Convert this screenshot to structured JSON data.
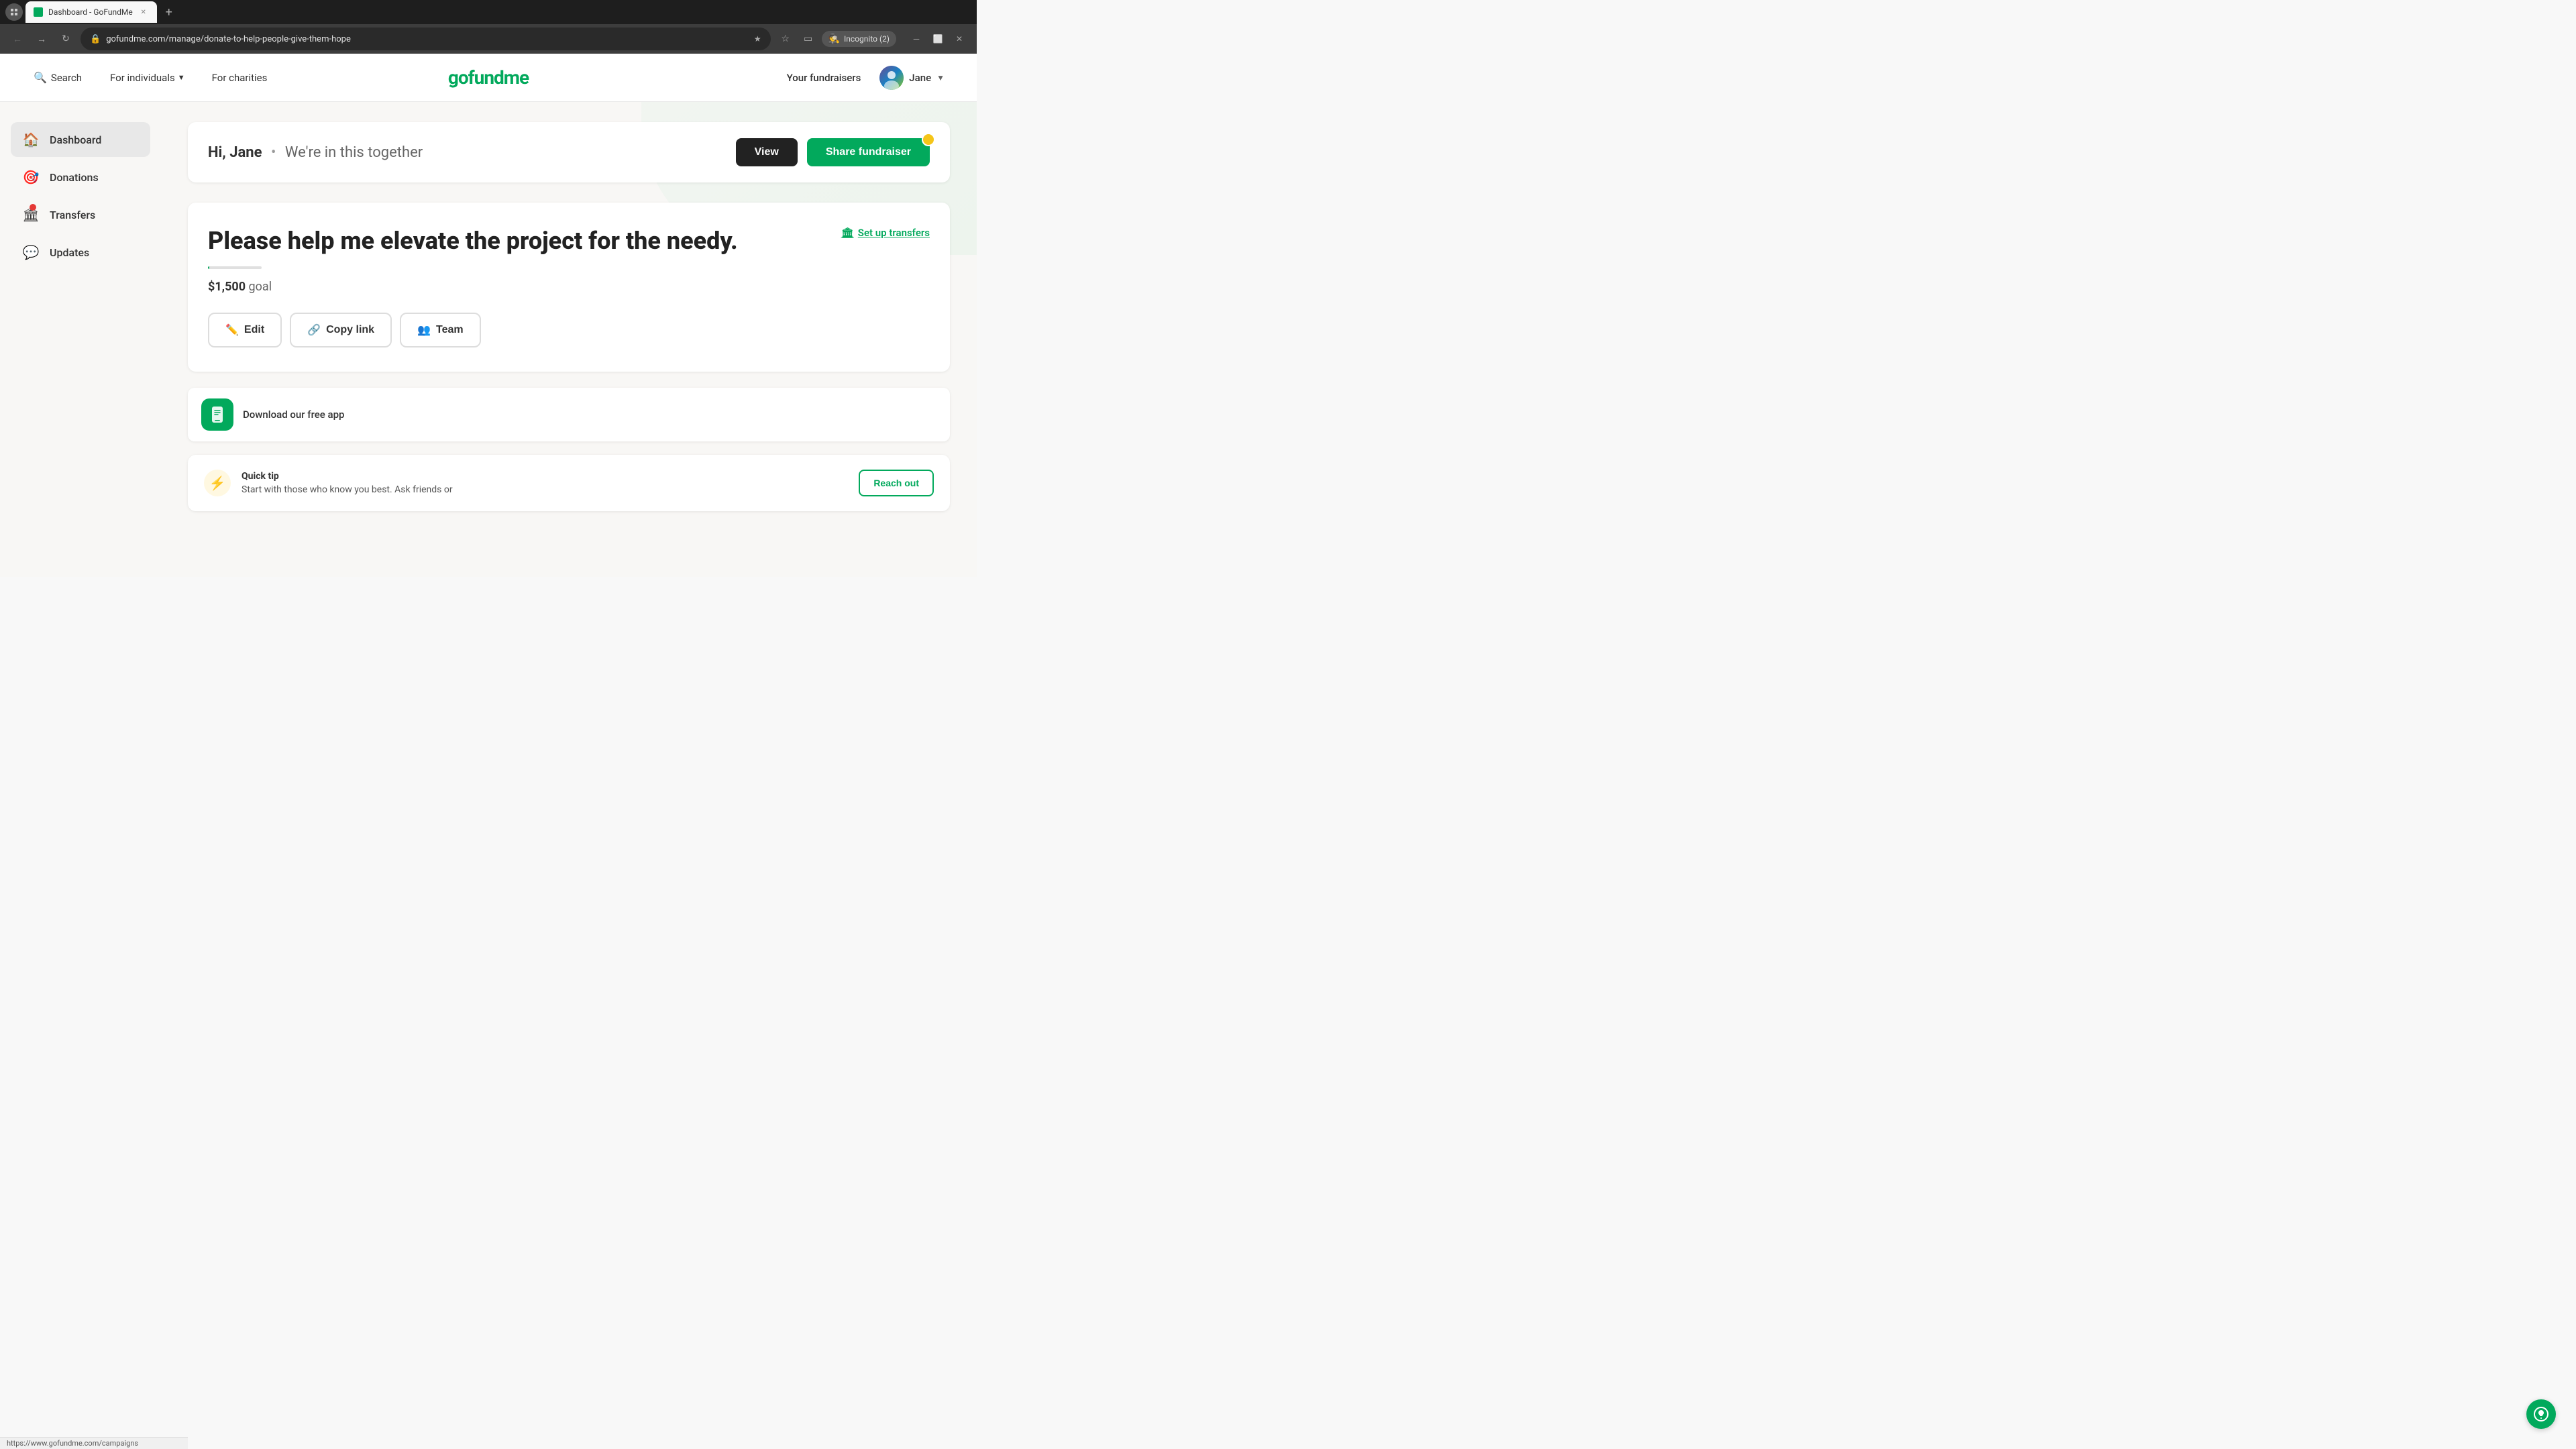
{
  "browser": {
    "tab_title": "Dashboard - GoFundMe",
    "address": "gofundme.com/manage/donate-to-help-people-give-them-hope",
    "new_tab_label": "+",
    "incognito_label": "Incognito (2)"
  },
  "header": {
    "search_label": "Search",
    "for_individuals_label": "For individuals",
    "for_charities_label": "For charities",
    "logo_text": "gofundme",
    "your_fundraisers_label": "Your fundraisers",
    "user_name": "Jane"
  },
  "sidebar": {
    "items": [
      {
        "id": "dashboard",
        "label": "Dashboard",
        "icon": "🏠",
        "active": true
      },
      {
        "id": "donations",
        "label": "Donations",
        "icon": "🎯"
      },
      {
        "id": "transfers",
        "label": "Transfers",
        "icon": "🏛",
        "has_notification": true
      },
      {
        "id": "updates",
        "label": "Updates",
        "icon": "💬"
      }
    ]
  },
  "dashboard": {
    "greeting_name": "Hi, Jane",
    "greeting_separator": "•",
    "greeting_subtitle": "We're in this together",
    "view_btn_label": "View",
    "share_btn_label": "Share fundraiser"
  },
  "fundraiser": {
    "title": "Please help me elevate the project for the needy.",
    "goal_amount": "$1,500",
    "goal_label": "goal",
    "setup_transfers_label": "Set up transfers",
    "edit_btn_label": "Edit",
    "copy_link_btn_label": "Copy link",
    "team_btn_label": "Team"
  },
  "download_app": {
    "label": "Download our free app"
  },
  "quick_tip": {
    "section_label": "Quick tip",
    "text": "Start with those who know you best. Ask friends or",
    "reach_out_label": "Reach out"
  },
  "status_bar": {
    "url": "https://www.gofundme.com/campaigns"
  }
}
